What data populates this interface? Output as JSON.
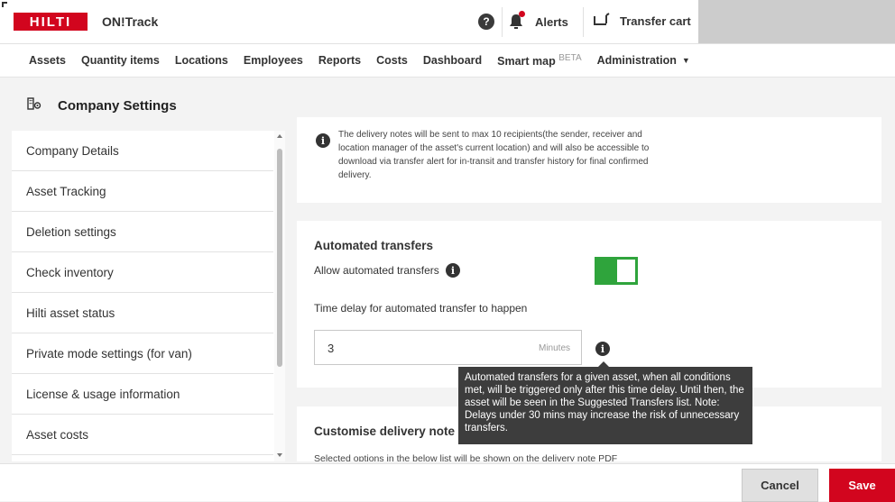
{
  "app": {
    "logo_text": "HILTI",
    "name": "ON!Track"
  },
  "topbar": {
    "help_icon_text": "?",
    "alerts_label": "Alerts",
    "transfer_cart_label": "Transfer cart"
  },
  "nav": {
    "items": [
      "Assets",
      "Quantity items",
      "Locations",
      "Employees",
      "Reports",
      "Costs",
      "Dashboard",
      "Smart map",
      "Administration"
    ],
    "beta_label": "BETA"
  },
  "settings": {
    "title": "Company Settings"
  },
  "sidebar": {
    "items": [
      "Company Details",
      "Asset Tracking",
      "Deletion settings",
      "Check inventory",
      "Hilti asset status",
      "Private mode settings (for van)",
      "License & usage information",
      "Asset costs"
    ]
  },
  "delivery_note": {
    "info_text": "The delivery notes will be sent to max 10 recipients(the sender, receiver and location manager of the asset's current location) and will also be accessible to download via transfer alert for in-transit and transfer history for final confirmed delivery."
  },
  "automated_transfers": {
    "title": "Automated transfers",
    "allow_label": "Allow automated transfers",
    "allow_enabled": true,
    "delay_label": "Time delay for automated transfer to happen",
    "delay_value": "3",
    "delay_unit": "Minutes",
    "tooltip": "Automated transfers for a given asset, when all conditions met, will be triggered only after this time delay. Until then, the asset will be seen in the Suggested Transfers list. Note: Delays under 30 mins may increase the risk of unnecessary transfers."
  },
  "customise_delivery": {
    "title": "Customise delivery note la",
    "sub_text": "Selected options in the below list will be shown on the delivery note PDF"
  },
  "footer": {
    "cancel_label": "Cancel",
    "save_label": "Save"
  },
  "colors": {
    "brand_red": "#d2051e",
    "toggle_green": "#2fa43c"
  }
}
